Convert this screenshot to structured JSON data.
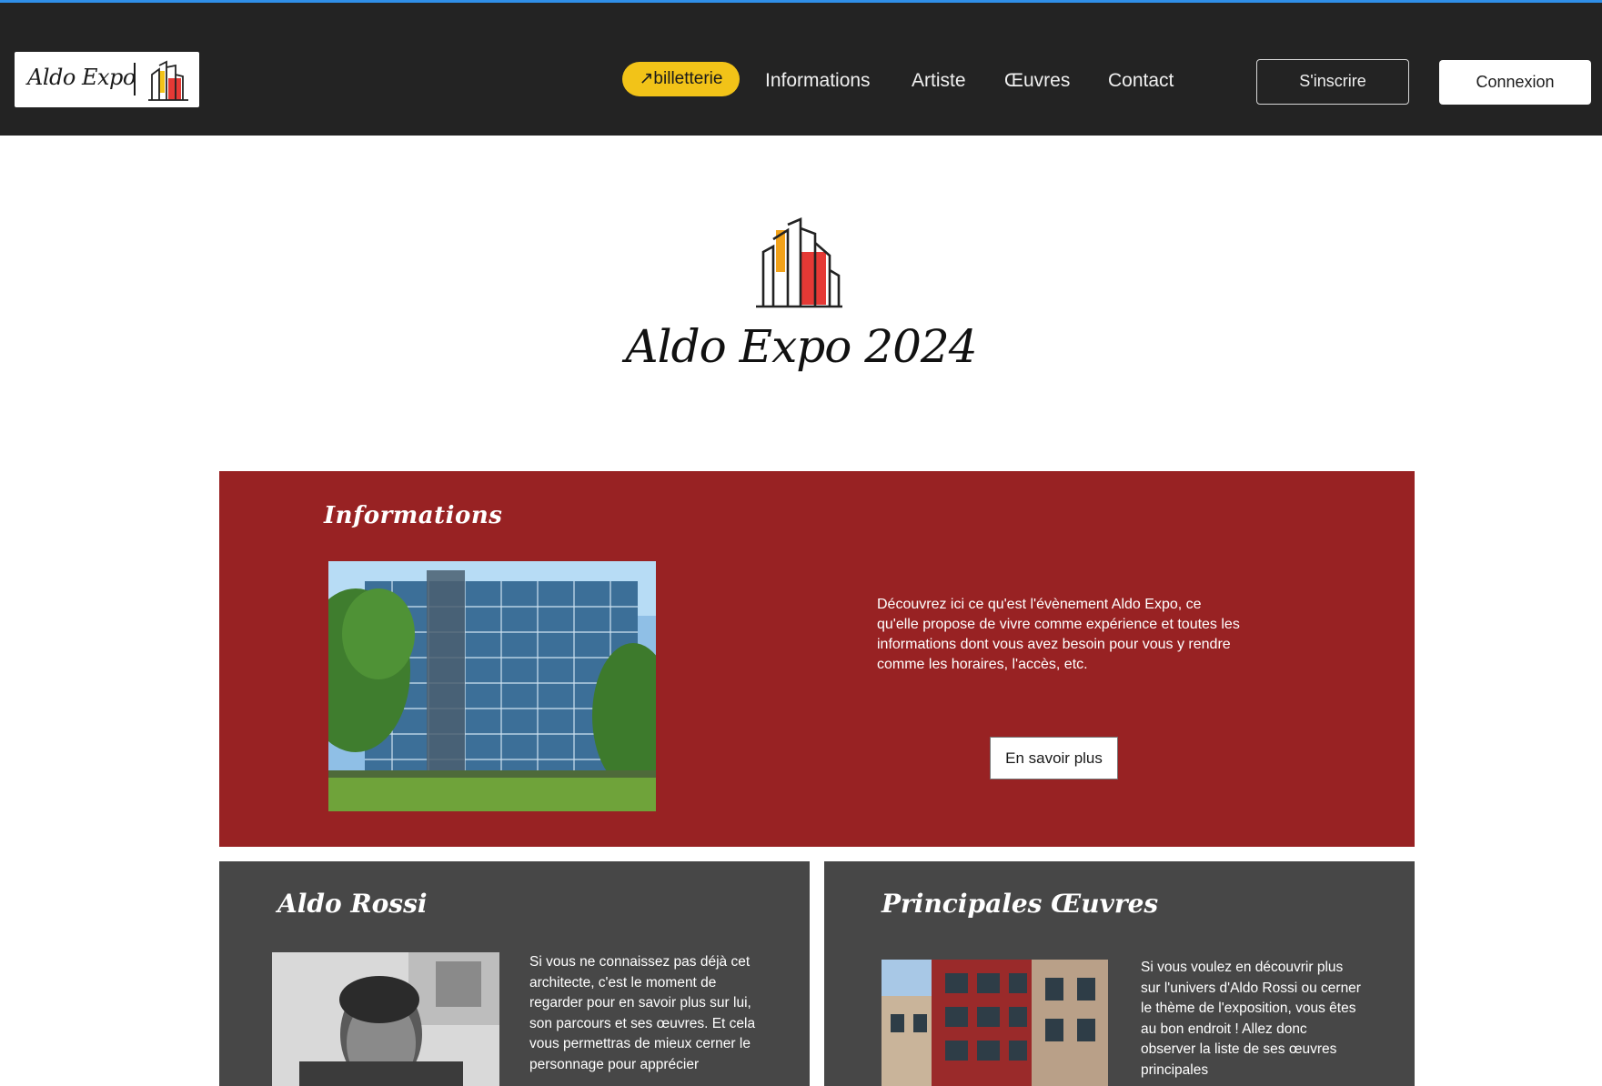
{
  "brand": {
    "logo_text": "Aldo Expo",
    "colors": {
      "header": "#232323",
      "accent_yellow": "#f2c318",
      "info_red": "#982223",
      "card_gray": "#474747"
    }
  },
  "nav": {
    "billetterie": "↗billetterie",
    "items": [
      "Informations",
      "Artiste",
      "Œuvres",
      "Contact"
    ],
    "signup": "S'inscrire",
    "login": "Connexion"
  },
  "hero": {
    "title": "Aldo Expo 2024",
    "icon": "buildings-logo-icon"
  },
  "info": {
    "title": "Informations",
    "text": "Découvrez ici ce qu'est l'évènement Aldo Expo, ce qu'elle propose de vivre comme expérience et toutes les informations dont vous avez besoin pour vous y rendre comme les horaires, l'accès, etc.",
    "button": "En savoir plus",
    "photo": "glass-building-photo"
  },
  "artist_card": {
    "title": "Aldo Rossi",
    "text": "Si vous ne connaissez pas déjà cet architecte, c'est le moment de regarder pour en savoir plus sur lui, son parcours et ses œuvres. Et cela vous permettras de mieux cerner le personnage pour apprécier",
    "photo": "portrait-photo"
  },
  "works_card": {
    "title": "Principales Œuvres",
    "text": "Si vous voulez en découvrir plus sur l'univers d'Aldo Rossi ou cerner le thème de l'exposition, vous êtes au bon endroit ! Allez donc observer la liste de ses œuvres principales",
    "photo": "facade-photo"
  }
}
